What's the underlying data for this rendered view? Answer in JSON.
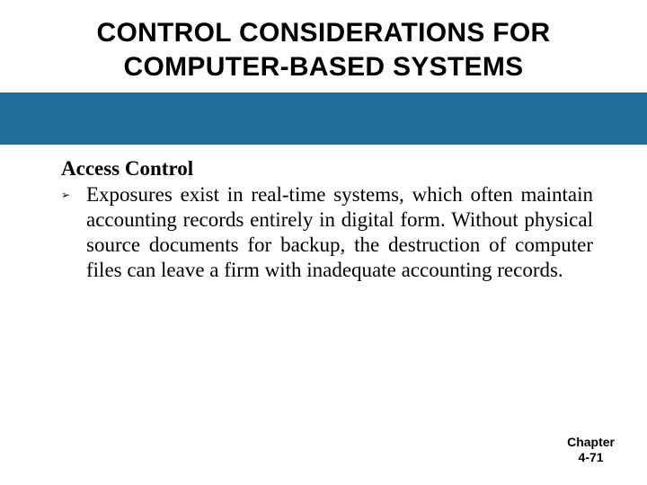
{
  "title_line1": "CONTROL CONSIDERATIONS FOR",
  "title_line2": "COMPUTER-BASED SYSTEMS",
  "section_heading": "Access Control",
  "bullets": [
    {
      "marker": "➢",
      "text": "Exposures exist in real-time systems, which often maintain accounting records entirely in digital form. Without physical source documents for backup, the destruction of computer files can leave a firm with inadequate accounting records."
    }
  ],
  "footer_line1": "Chapter",
  "footer_line2": "4-71"
}
